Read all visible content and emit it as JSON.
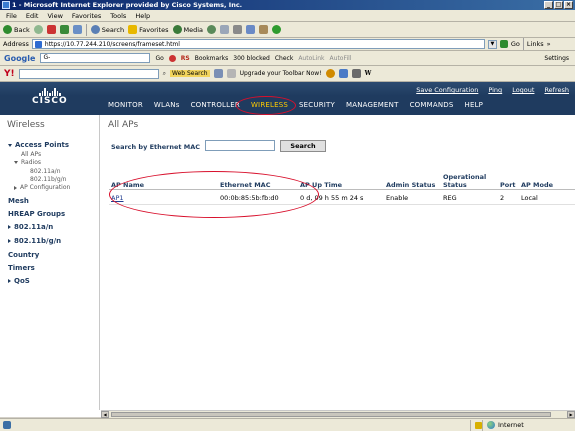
{
  "window": {
    "title": "1 - Microsoft Internet Explorer provided by Cisco Systems, Inc.",
    "controls": [
      "_",
      "□",
      "×"
    ]
  },
  "menubar": [
    "File",
    "Edit",
    "View",
    "Favorites",
    "Tools",
    "Help"
  ],
  "toolbar": {
    "back": "Back",
    "search": "Search",
    "favorites": "Favorites",
    "media": "Media"
  },
  "address": {
    "label": "Address",
    "url": "https://10.77.244.210/screens/frameset.html",
    "go": "Go",
    "links": "Links"
  },
  "googlebar": {
    "brand": "Google",
    "field_prefix": "G-",
    "go": "Go",
    "rs": "RS",
    "bookmarks": "Bookmarks",
    "blocked": "300 blocked",
    "check": "Check",
    "autolink": "AutoLink",
    "autofill": "AutoFill",
    "settings": "Settings"
  },
  "yahoobar": {
    "brand": "Y!",
    "websearch": "Web Search",
    "upgrade": "Upgrade your Toolbar Now!"
  },
  "cisco": {
    "logo": "CISCO",
    "header_links": [
      "Save Configuration",
      "Ping",
      "Logout",
      "Refresh"
    ],
    "nav": [
      "MONITOR",
      "WLANs",
      "CONTROLLER",
      "WIRELESS",
      "SECURITY",
      "MANAGEMENT",
      "COMMANDS",
      "HELP"
    ],
    "active_nav": "WIRELESS",
    "accent": "#1f3b5f",
    "highlight_color": "#d8102c"
  },
  "sidebar": {
    "title": "Wireless",
    "access_points": "Access Points",
    "all_aps": "All APs",
    "radios": "Radios",
    "radio_a": "802.11a/n",
    "radio_bg": "802.11b/g/n",
    "ap_config": "AP Configuration",
    "mesh": "Mesh",
    "hreap": "HREAP Groups",
    "b80211an": "802.11a/n",
    "b80211bgn": "802.11b/g/n",
    "country": "Country",
    "timers": "Timers",
    "qos": "QoS"
  },
  "main": {
    "title": "All APs",
    "search_label": "Search by Ethernet MAC",
    "search_value": "",
    "search_button": "Search",
    "columns": [
      "AP Name",
      "Ethernet MAC",
      "AP Up Time",
      "Admin Status",
      "Operational Status",
      "Port",
      "AP Mode"
    ],
    "rows": [
      [
        "AP1",
        "00:0b:85:5b:fb:d0",
        "0 d, 09 h 55 m 24 s",
        "Enable",
        "REG",
        "2",
        "Local"
      ]
    ]
  },
  "status": {
    "zone": "Internet"
  }
}
